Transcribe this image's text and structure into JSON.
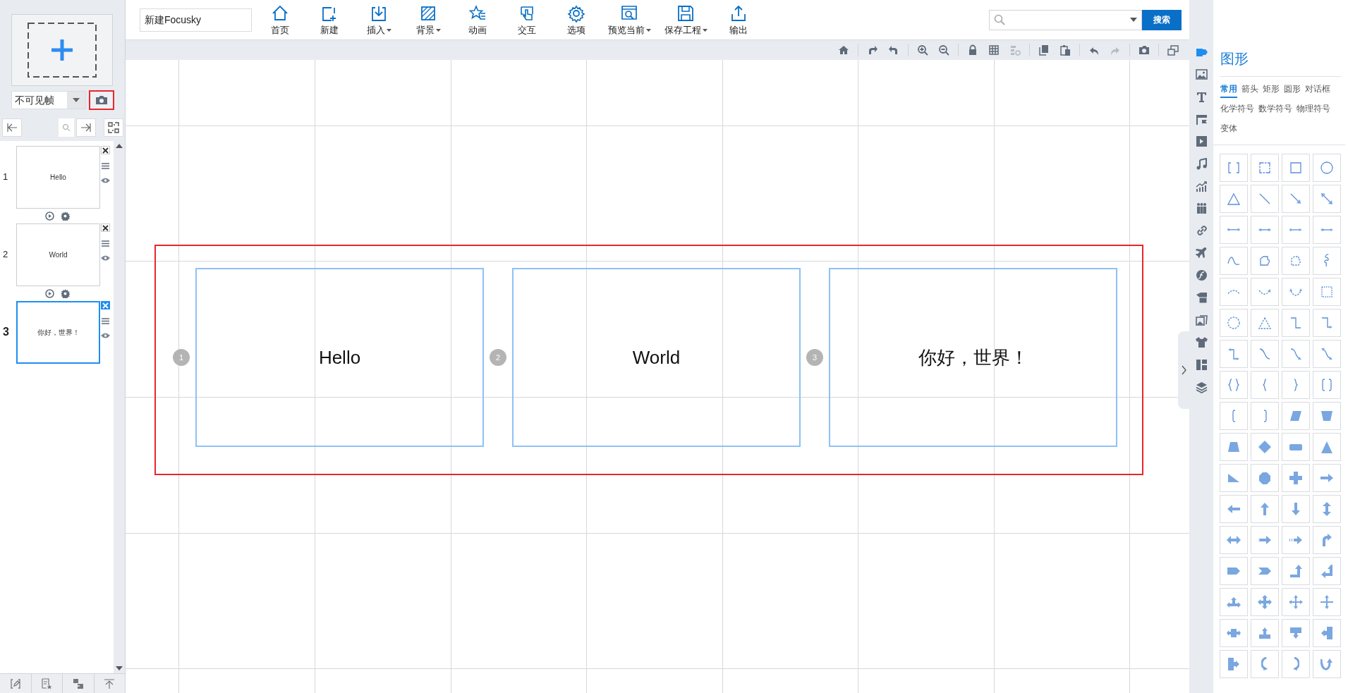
{
  "project_title": "新建Focusky",
  "toolbar": [
    {
      "label": "首页",
      "dropdown": false
    },
    {
      "label": "新建",
      "dropdown": false
    },
    {
      "label": "插入",
      "dropdown": true
    },
    {
      "label": "背景",
      "dropdown": true
    },
    {
      "label": "动画",
      "dropdown": false
    },
    {
      "label": "交互",
      "dropdown": false
    },
    {
      "label": "选项",
      "dropdown": false
    },
    {
      "label": "预览当前",
      "dropdown": true
    },
    {
      "label": "保存工程",
      "dropdown": true
    },
    {
      "label": "输出",
      "dropdown": false
    }
  ],
  "search": {
    "button": "搜索"
  },
  "frame_panel": {
    "frame_type": "不可见帧",
    "frames": [
      {
        "number": "1",
        "text": "Hello",
        "selected": false,
        "path_controls": true
      },
      {
        "number": "2",
        "text": "World",
        "selected": false,
        "path_controls": true
      },
      {
        "number": "3",
        "text": "你好，世界！",
        "selected": true,
        "path_controls": false
      }
    ]
  },
  "canvas_tools": [
    {
      "disabled": false
    },
    {
      "disabled": false
    },
    {
      "disabled": false
    },
    {
      "disabled": false
    },
    {
      "disabled": false
    },
    {
      "disabled": false
    },
    {
      "disabled": false
    },
    {
      "disabled": true
    },
    {
      "disabled": false
    },
    {
      "disabled": false
    },
    {
      "disabled": false
    },
    {
      "disabled": true
    },
    {
      "disabled": false
    },
    {
      "disabled": false
    }
  ],
  "canvas": {
    "frames": [
      {
        "number": "1",
        "text": "Hello"
      },
      {
        "number": "2",
        "text": "World"
      },
      {
        "number": "3",
        "text": "你好，世界！"
      }
    ]
  },
  "side_tabs": [
    {
      "selected": true
    },
    {
      "selected": false
    },
    {
      "selected": false
    },
    {
      "selected": false
    },
    {
      "selected": false
    },
    {
      "selected": false
    },
    {
      "selected": false
    },
    {
      "selected": false
    },
    {
      "selected": false
    },
    {
      "selected": false
    },
    {
      "selected": false
    },
    {
      "selected": false
    },
    {
      "selected": false
    },
    {
      "selected": false
    },
    {
      "selected": false
    },
    {
      "selected": false
    }
  ],
  "shape_panel": {
    "title": "图形",
    "tabs": [
      {
        "label": "常用",
        "selected": true
      },
      {
        "label": "箭头",
        "selected": false
      },
      {
        "label": "矩形",
        "selected": false
      },
      {
        "label": "圆形",
        "selected": false
      },
      {
        "label": "对话框",
        "selected": false
      },
      {
        "label": "化学符号",
        "selected": false
      },
      {
        "label": "数学符号",
        "selected": false
      },
      {
        "label": "物理符号",
        "selected": false
      },
      {
        "label": "变体",
        "selected": false
      }
    ]
  }
}
